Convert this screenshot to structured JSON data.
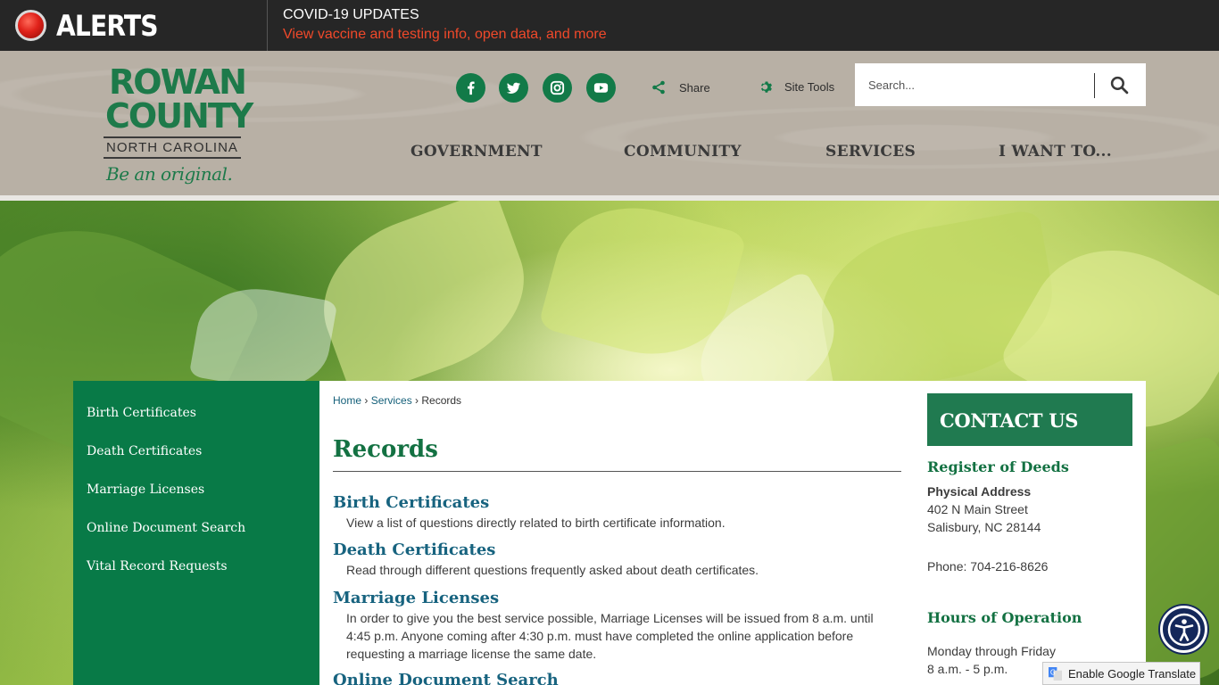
{
  "alerts": {
    "label": "ALERTS",
    "title": "COVID-19 UPDATES",
    "link": "View vaccine and testing info, open data, and more"
  },
  "logo": {
    "line1": "ROWAN",
    "line2": "COUNTY",
    "state": "NORTH CAROLINA",
    "tagline": "Be an original."
  },
  "social": [
    {
      "name": "facebook-icon",
      "glyph": "f"
    },
    {
      "name": "twitter-icon",
      "glyph": "t"
    },
    {
      "name": "instagram-icon",
      "glyph": "i"
    },
    {
      "name": "youtube-icon",
      "glyph": "y"
    }
  ],
  "tools": {
    "share": "Share",
    "site_tools": "Site Tools"
  },
  "search": {
    "placeholder": "Search..."
  },
  "nav": [
    "GOVERNMENT",
    "COMMUNITY",
    "SERVICES",
    "I WANT TO..."
  ],
  "sidebar": {
    "items": [
      "Birth Certificates",
      "Death Certificates",
      "Marriage Licenses",
      "Online Document Search",
      "Vital Record Requests"
    ]
  },
  "breadcrumb": {
    "home": "Home",
    "services": "Services",
    "current": "Records"
  },
  "page": {
    "title": "Records",
    "records": [
      {
        "title": "Birth Certificates",
        "desc": "View a list of questions directly related to birth certificate information."
      },
      {
        "title": "Death Certificates",
        "desc": "Read through different questions frequently asked about death certificates."
      },
      {
        "title": "Marriage Licenses",
        "desc": "In order to give you the best service possible, Marriage Licenses will be issued from 8 a.m. until 4:45 p.m. Anyone coming after 4:30 p.m. must have completed the online application before requesting a marriage license the same date."
      },
      {
        "title": "Online Document Search",
        "desc": ""
      }
    ]
  },
  "contact": {
    "heading": "CONTACT US",
    "office": "Register of Deeds",
    "address_label": "Physical Address",
    "address_line1": "402 N Main Street",
    "address_line2": "Salisbury, NC 28144",
    "phone": "Phone: 704-216-8626",
    "hours_heading": "Hours of Operation",
    "hours_days": "Monday through Friday",
    "hours_time": "8 a.m. - 5 p.m."
  },
  "translate": {
    "label": "Enable Google Translate"
  },
  "colors": {
    "brand_green": "#087a47",
    "link_blue": "#17637f",
    "alert_red": "#f0492a"
  }
}
